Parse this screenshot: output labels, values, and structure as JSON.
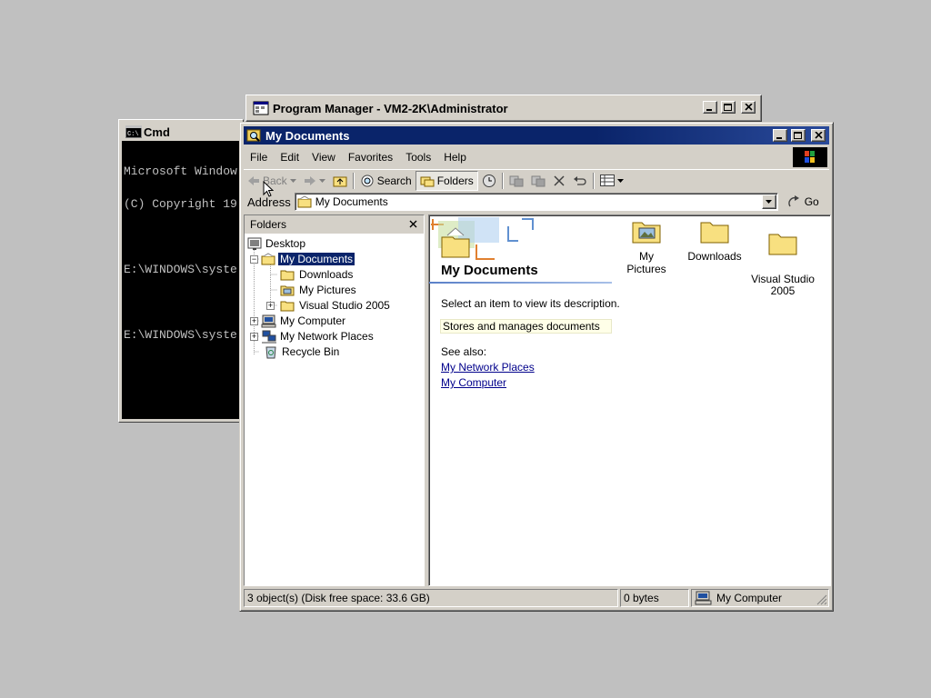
{
  "program_manager": {
    "title": "Program Manager - VM2-2K\\Administrator"
  },
  "cmd": {
    "title": "Cmd",
    "lines": [
      "Microsoft Window",
      "(C) Copyright 19",
      "",
      "E:\\WINDOWS\\syste",
      "",
      "E:\\WINDOWS\\syste"
    ]
  },
  "explorer": {
    "title": "My Documents",
    "menu": [
      "File",
      "Edit",
      "View",
      "Favorites",
      "Tools",
      "Help"
    ],
    "toolbar": {
      "back": "Back",
      "search": "Search",
      "folders": "Folders"
    },
    "address": {
      "label": "Address",
      "value": "My Documents",
      "go": "Go"
    },
    "folders_pane": {
      "title": "Folders",
      "items": [
        {
          "label": "Desktop",
          "icon": "desktop-icon",
          "level": 0,
          "expander": ""
        },
        {
          "label": "My Documents",
          "icon": "my-documents-icon",
          "level": 1,
          "expander": "-",
          "selected": true
        },
        {
          "label": "Downloads",
          "icon": "folder-icon",
          "level": 2,
          "expander": ""
        },
        {
          "label": "My Pictures",
          "icon": "pictures-folder-icon",
          "level": 2,
          "expander": ""
        },
        {
          "label": "Visual Studio 2005",
          "icon": "folder-icon",
          "level": 2,
          "expander": "+"
        },
        {
          "label": "My Computer",
          "icon": "computer-icon",
          "level": 1,
          "expander": "+"
        },
        {
          "label": "My Network Places",
          "icon": "network-icon",
          "level": 1,
          "expander": "+"
        },
        {
          "label": "Recycle Bin",
          "icon": "recycle-bin-icon",
          "level": 1,
          "expander": ""
        }
      ]
    },
    "info": {
      "heading": "My Documents",
      "prompt": "Select an item to view its description.",
      "description": "Stores and manages documents",
      "see_also": "See also:",
      "links": [
        "My Network Places",
        "My Computer"
      ]
    },
    "files": [
      {
        "label": "My Pictures",
        "icon": "pictures-folder-icon"
      },
      {
        "label": "Downloads",
        "icon": "folder-icon"
      },
      {
        "label": "Visual Studio\n2005",
        "icon": "folder-icon"
      }
    ],
    "status": {
      "objects": "3 object(s) (Disk free space: 33.6 GB)",
      "size": "0 bytes",
      "zone": "My Computer"
    }
  },
  "colors": {
    "title_active": "#0a246a",
    "desktop": "#c0c0c0",
    "face": "#d4d0c8",
    "link": "#00008b"
  }
}
